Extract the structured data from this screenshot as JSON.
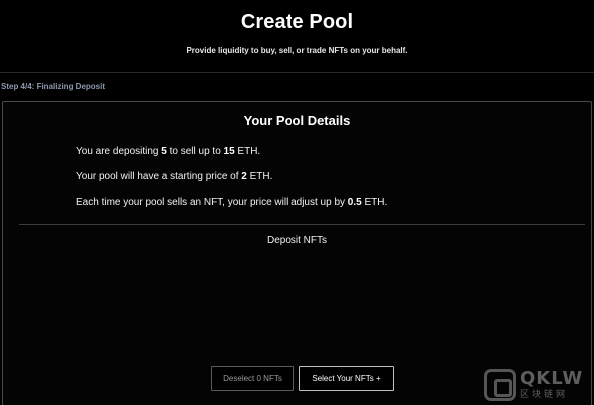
{
  "header": {
    "title": "Create Pool",
    "subtitle": "Provide liquidity to buy, sell, or trade NFTs on your behalf."
  },
  "step": {
    "label": "Step 4/4: Finalizing Deposit"
  },
  "pool_details": {
    "title": "Your Pool Details",
    "line1": {
      "prefix": "You are depositing ",
      "count": "5",
      "middle": " to sell up to ",
      "amount": "15",
      "suffix": " ETH."
    },
    "line2": {
      "prefix": "Your pool will have a starting price of ",
      "price": "2",
      "suffix": " ETH."
    },
    "line3": {
      "prefix": "Each time your pool sells an NFT, your price will adjust up by ",
      "delta": "0.5",
      "suffix": " ETH."
    }
  },
  "deposit": {
    "heading": "Deposit NFTs",
    "deselect_label": "Deselect 0 NFTs",
    "select_label": "Select Your NFTs +"
  },
  "watermark": {
    "brand": "QKLW",
    "sub": "区块链网"
  },
  "colors": {
    "background": "#000000",
    "text": "#ffffff",
    "step_label": "#8d99ad",
    "card_border": "#4a4a4a",
    "muted_button_text": "#9a9a9a"
  }
}
